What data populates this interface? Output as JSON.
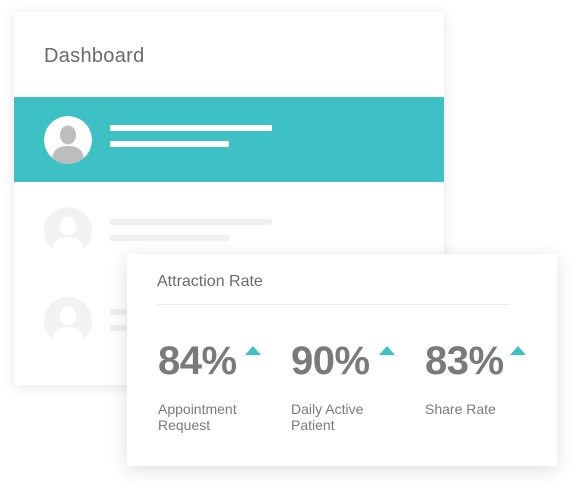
{
  "colors": {
    "accent": "#3ec1c4",
    "text": "#6b6b6b",
    "metric_text": "#7a7a7a"
  },
  "dashboard": {
    "title": "Dashboard",
    "rows": [
      {
        "state": "selected",
        "avatar": "user-avatar-icon"
      },
      {
        "state": "faded",
        "avatar": "user-avatar-icon"
      },
      {
        "state": "faded",
        "avatar": "user-avatar-icon"
      }
    ]
  },
  "attraction": {
    "title": "Attraction Rate",
    "metrics": [
      {
        "value": "84%",
        "label": "Appointment Request",
        "trend": "up",
        "icon": "triangle-up-icon"
      },
      {
        "value": "90%",
        "label": "Daily Active Patient",
        "trend": "up",
        "icon": "triangle-up-icon"
      },
      {
        "value": "83%",
        "label": "Share Rate",
        "trend": "up",
        "icon": "triangle-up-icon"
      }
    ]
  }
}
